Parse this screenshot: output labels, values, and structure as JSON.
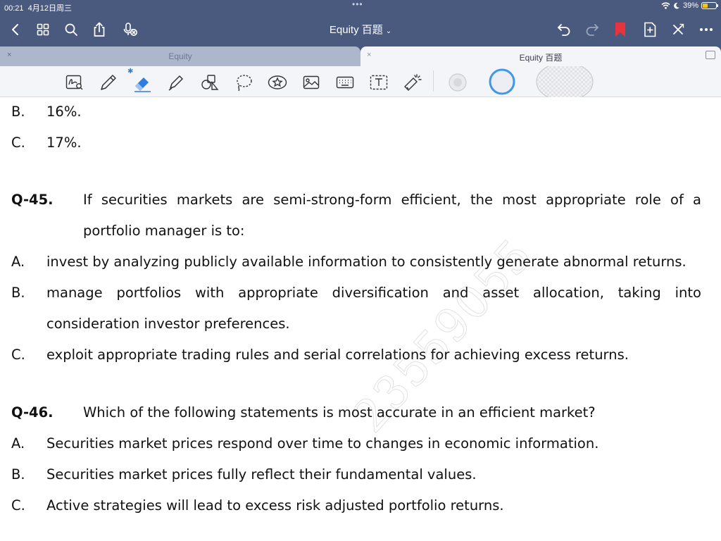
{
  "status_bar": {
    "time": "00:21",
    "date": "4月12日周三",
    "battery": "39%",
    "battery_level": 0.39,
    "dots": "•••"
  },
  "nav": {
    "title": "Equity 百题",
    "title_chevron": "⌄"
  },
  "tabs": [
    {
      "label": "Equity",
      "close": "×",
      "active": false
    },
    {
      "label": "Equity 百题",
      "close": "×",
      "active": true
    }
  ],
  "icons": {
    "back": "back-icon",
    "grid": "grid-icon",
    "search": "search-icon",
    "share": "share-icon",
    "mic": "mic-icon",
    "undo": "undo-icon",
    "redo": "redo-icon",
    "bookmark": "bookmark-icon",
    "add_page": "add-page-icon",
    "close_edit": "close-icon",
    "more": "more-icon"
  },
  "colors": {
    "nav_bg": "#4a5a7e",
    "bookmark": "#e8323c",
    "eraser": "#2f7de0",
    "active_tab_bg": "#f4f5f8",
    "inactive_tab_bg": "#adb7cb"
  },
  "document": {
    "prev_options": [
      {
        "letter": "B.",
        "text": "16%."
      },
      {
        "letter": "C.",
        "text": "17%."
      }
    ],
    "questions": [
      {
        "number": "Q-45.",
        "text_line1": "If securities markets are semi-strong-form efficient, the most appropriate role of a",
        "text_line2": "portfolio manager is to:",
        "options": [
          {
            "letter": "A.",
            "text": "invest by analyzing publicly available information to consistently generate abnormal returns."
          },
          {
            "letter": "B.",
            "text_line1": "manage portfolios with appropriate diversification and asset allocation, taking into",
            "text_line2": "consideration investor preferences."
          },
          {
            "letter": "C.",
            "text": "exploit appropriate trading rules and serial correlations for achieving excess returns."
          }
        ]
      },
      {
        "number": "Q-46.",
        "text": "Which of the following statements is most accurate in an efficient market?",
        "options": [
          {
            "letter": "A.",
            "text": "Securities market prices respond over time to changes in economic information."
          },
          {
            "letter": "B.",
            "text": "Securities market prices fully reflect their fundamental values."
          },
          {
            "letter": "C.",
            "text": "Active strategies will lead to excess risk adjusted portfolio returns."
          }
        ]
      }
    ],
    "watermark": "23559055"
  }
}
